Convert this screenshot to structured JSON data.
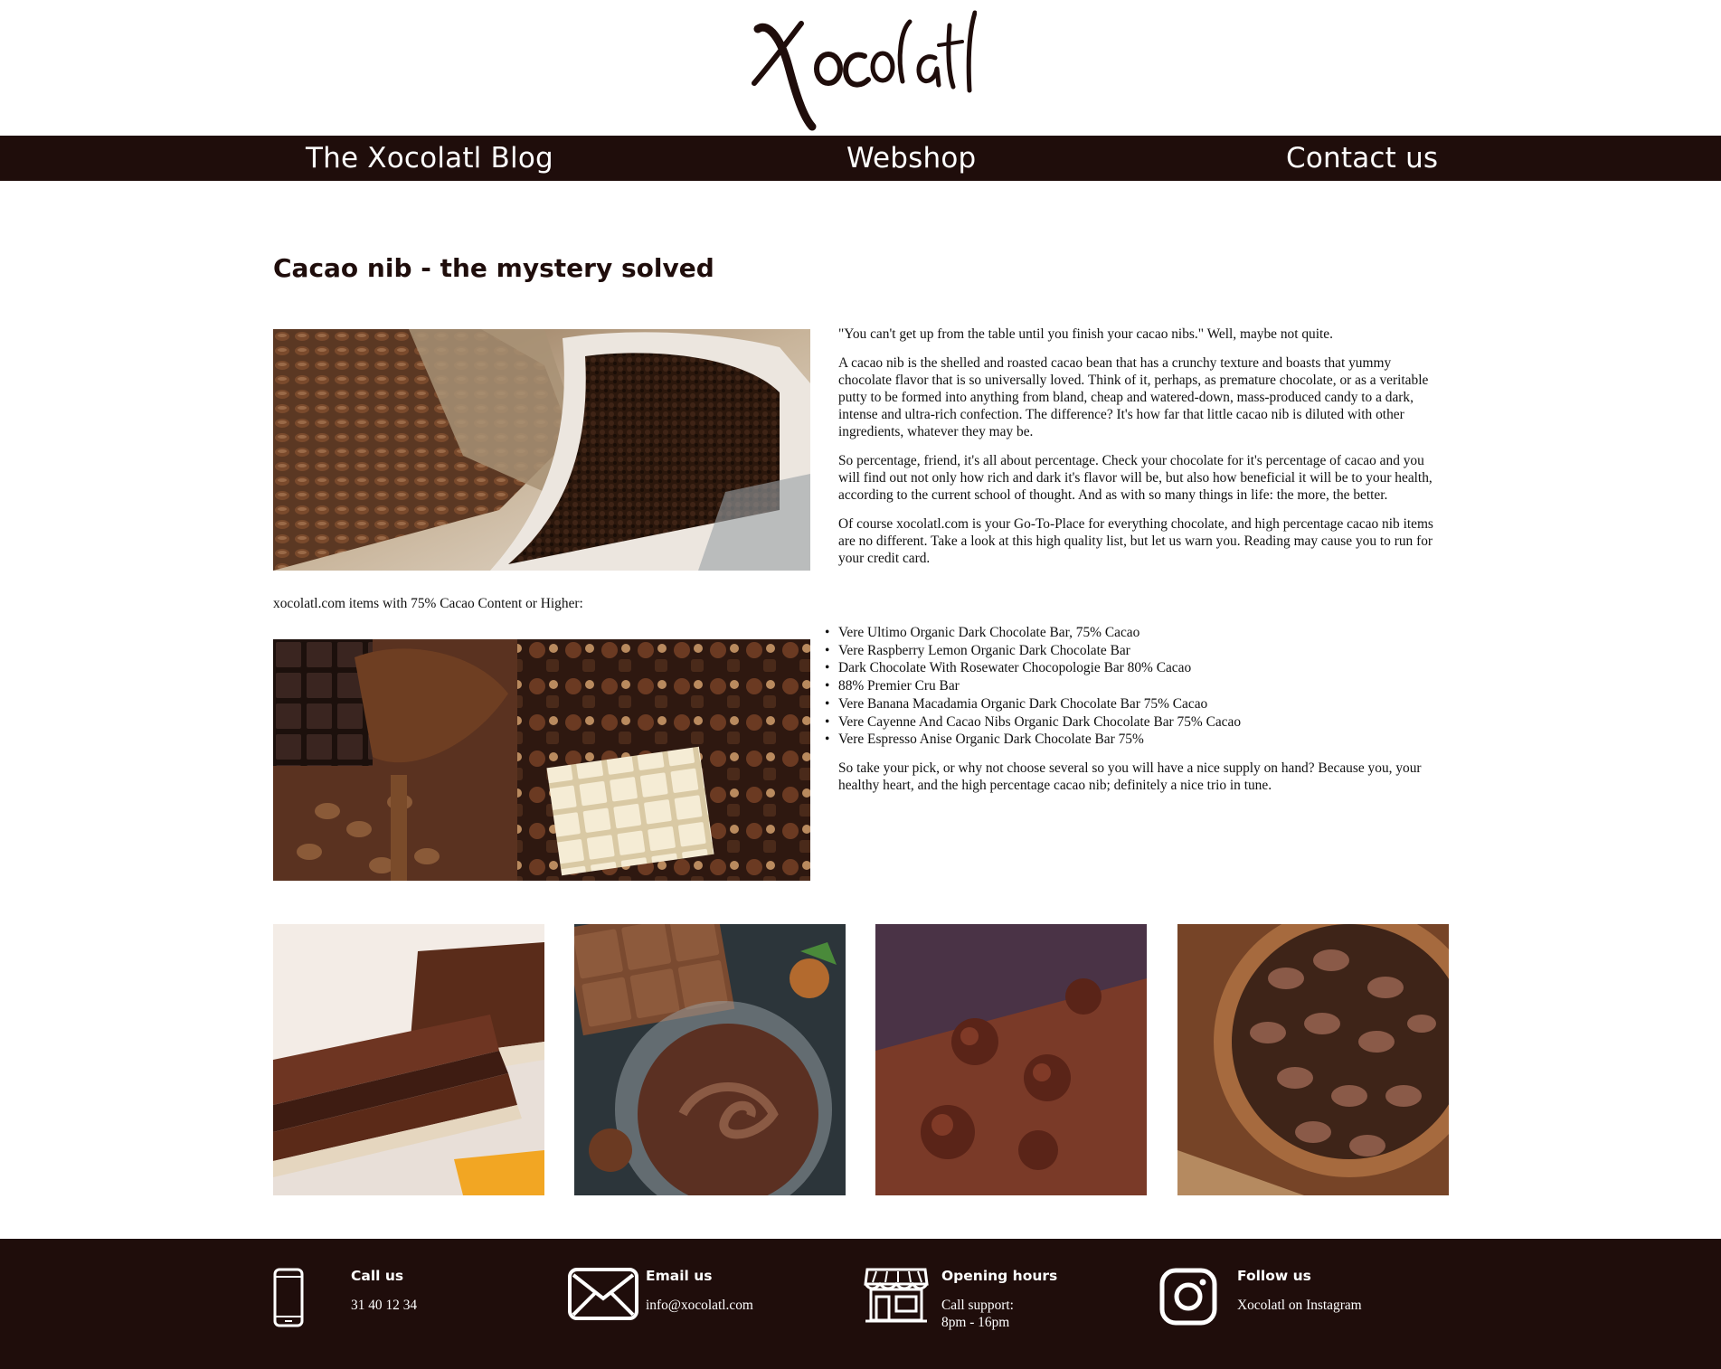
{
  "brand": {
    "logo_text": "Xocolatl",
    "background": "#1f0d0b"
  },
  "nav": {
    "items": [
      {
        "label": "The Xocolatl Blog"
      },
      {
        "label": "Webshop"
      },
      {
        "label": "Contact us"
      }
    ]
  },
  "article": {
    "title": "Cacao nib - the mystery solved",
    "paragraphs": [
      "\"You can't get up from the table until you finish your cacao nibs.\" Well, maybe not quite.",
      "A cacao nib is the shelled and roasted cacao bean that has a crunchy texture and boasts that yummy chocolate flavor that is so universally loved. Think of it, perhaps, as premature chocolate, or as a veritable putty to be formed into anything from bland, cheap and watered-down, mass-produced candy to a dark, intense and ultra-rich confection. The difference? It's how far that little cacao nib is diluted with other ingredients, whatever they may be.",
      "So percentage, friend, it's all about percentage. Check your chocolate for it's percentage of cacao and you will find out not only how rich and dark it's flavor will be, but also how beneficial it will be to your health, according to the current school of thought. And as with so many things in life: the more, the better.",
      "Of course xocolatl.com is your Go-To-Place for everything chocolate, and high percentage cacao nib items are no different. Take a look at this high quality list, but let us warn you. Reading may cause you to run for your credit card."
    ],
    "list_intro": "xocolatl.com items with 75% Cacao Content or Higher:",
    "items": [
      "Vere Ultimo Organic Dark Chocolate Bar, 75% Cacao",
      "Vere Raspberry Lemon Organic Dark Chocolate Bar",
      "Dark Chocolate With Rosewater Chocopologie Bar 80% Cacao",
      "88% Premier Cru Bar",
      "Vere Banana Macadamia Organic Dark Chocolate Bar 75% Cacao",
      "Vere Cayenne And Cacao Nibs Organic Dark Chocolate Bar 75% Cacao",
      "Vere Espresso Anise Organic Dark Chocolate Bar 75%"
    ],
    "closing": "So take your pick, or why not choose several so you will have a nice supply on hand? Because you, your healthy heart, and the high percentage cacao nib; definitely a nice trio in tune."
  },
  "footer": {
    "call": {
      "title": "Call us",
      "text": "31 40 12 34",
      "icon": "phone-icon"
    },
    "email": {
      "title": "Email us",
      "text": "info@xocolatl.com",
      "icon": "envelope-icon"
    },
    "hours": {
      "title": "Opening hours",
      "line1": "Call support:",
      "line2": "8pm - 16pm",
      "icon": "shop-icon"
    },
    "follow": {
      "title": "Follow us",
      "text": "Xocolatl on Instagram",
      "icon": "instagram-icon"
    }
  }
}
